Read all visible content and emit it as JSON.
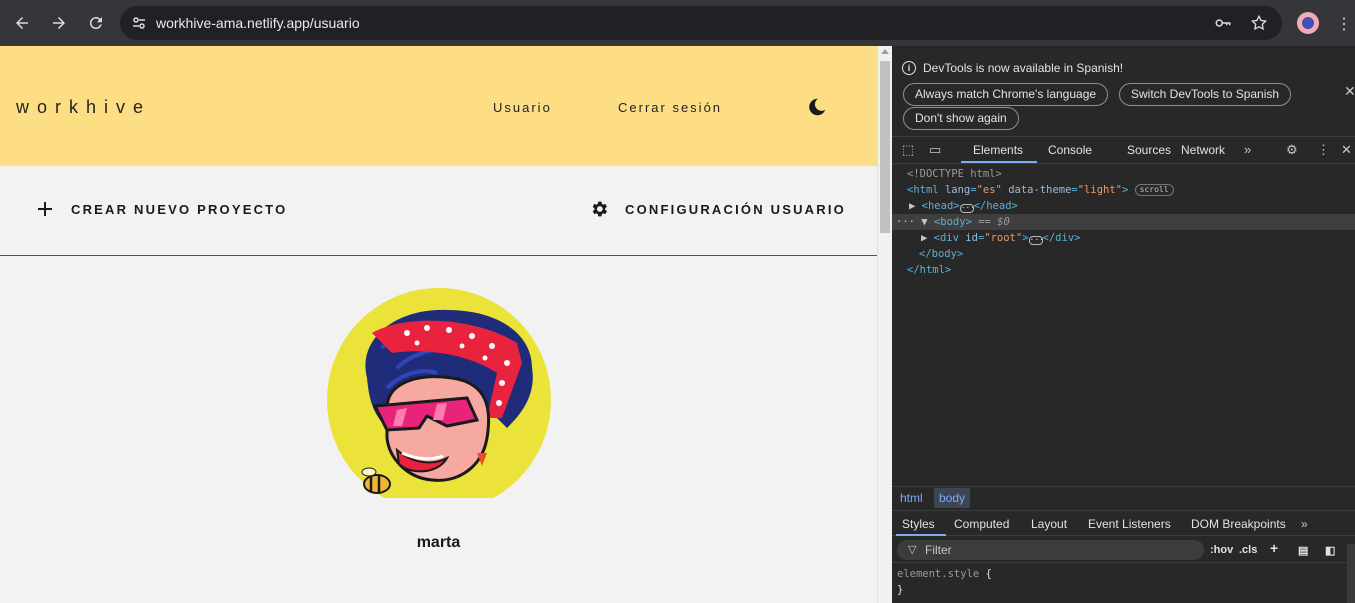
{
  "browser": {
    "url": "workhive-ama.netlify.app/usuario",
    "icons": [
      "back-icon",
      "forward-icon",
      "reload-icon",
      "site-info-icon",
      "password-key-icon",
      "bookmark-star-icon",
      "profile-avatar",
      "menu-kebab-icon"
    ]
  },
  "site": {
    "logo": "workhive",
    "nav": {
      "usuario": "Usuario",
      "cerrar_sesion": "Cerrar sesión"
    },
    "actions": {
      "new_project": "CREAR NUEVO PROYECTO",
      "user_config": "CONFIGURACIÓN USUARIO"
    },
    "user": {
      "name": "marta"
    },
    "colors": {
      "header_bg": "#fede85",
      "page_bg": "#f2f2f2",
      "divider": "#8b3a1a",
      "avatar_bg": "#ebe23a"
    }
  },
  "devtools": {
    "info": {
      "message": "DevTools is now available in Spanish!",
      "match_button": "Always match Chrome's language",
      "switch_button": "Switch DevTools to Spanish",
      "dont_show_button": "Don't show again"
    },
    "tabs": {
      "elements": "Elements",
      "console": "Console",
      "sources": "Sources",
      "network": "Network"
    },
    "dom": {
      "doctype": "<!DOCTYPE html>",
      "html_open": "<html",
      "lang_attr": "lang",
      "lang_val": "\"es\"",
      "theme_attr": "data-theme",
      "theme_val": "\"light\"",
      "scroll_badge": "scroll",
      "head": "<head>",
      "head_close": "</head>",
      "body": "<body>",
      "body_eq": "== $0",
      "div_open": "<div",
      "id_attr": "id",
      "id_val": "\"root\"",
      "div_close": "</div>",
      "body_close": "</body>",
      "html_close": "</html>"
    },
    "crumbs": {
      "html": "html",
      "body": "body"
    },
    "styles_tabs": {
      "styles": "Styles",
      "computed": "Computed",
      "layout": "Layout",
      "event_listeners": "Event Listeners",
      "dom_breakpoints": "DOM Breakpoints"
    },
    "filter": {
      "placeholder": "Filter",
      "hov": ":hov",
      "cls": ".cls"
    },
    "style_rule": {
      "selector": "element.style",
      "open": "{",
      "close": "}"
    }
  }
}
